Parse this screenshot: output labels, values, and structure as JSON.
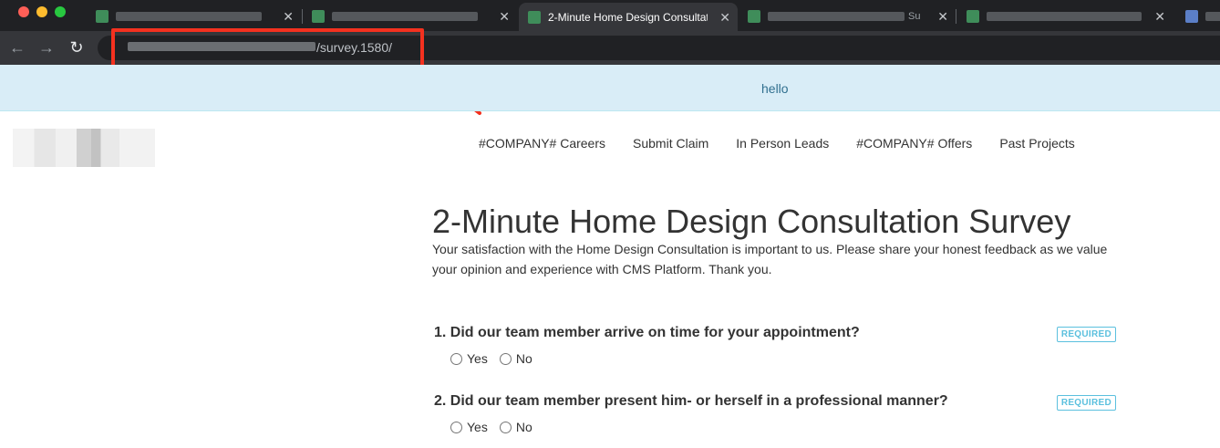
{
  "browser": {
    "tabs": [
      {
        "id": "tab1",
        "title": "",
        "active": false,
        "favicon": "green-square-icon"
      },
      {
        "id": "tab2",
        "title": "",
        "active": false,
        "favicon": "green-square-icon"
      },
      {
        "id": "tab3",
        "title": "2-Minute Home Design Consultation Survey",
        "active": true,
        "favicon": "survey-favicon-icon"
      },
      {
        "id": "tab4",
        "title": "Su",
        "active": false,
        "favicon": "green-square-icon"
      },
      {
        "id": "tab5",
        "title": "",
        "active": false,
        "favicon": "green-square-icon"
      },
      {
        "id": "tab6",
        "title": "",
        "active": false,
        "favicon": "blue-doc-icon"
      }
    ],
    "url_visible": "/survey.1580/",
    "icons": {
      "back": "←",
      "forward": "→",
      "reload": "↻",
      "close": "✕"
    }
  },
  "banner": {
    "text": "hello"
  },
  "nav": {
    "items": [
      "#COMPANY# Careers",
      "Submit Claim",
      "In Person Leads",
      "#COMPANY# Offers",
      "Past Projects"
    ]
  },
  "survey": {
    "title": "2-Minute Home Design Consultation Survey",
    "intro": "Your satisfaction with the Home Design Consultation is important to us. Please share your honest feedback as we value your opinion and experience with CMS Platform. Thank you.",
    "questions": [
      {
        "text": "1. Did our team member arrive on time for your appointment?",
        "badge": "REQUIRED",
        "options": [
          "Yes",
          "No"
        ]
      },
      {
        "text": "2. Did our team member present him- or herself in a professional manner?",
        "badge": "REQUIRED",
        "options": [
          "Yes",
          "No"
        ]
      }
    ]
  },
  "colors": {
    "annotation_red": "#f4311f",
    "banner_bg": "#d9edf7",
    "banner_text": "#31708f",
    "badge": "#5bc0de"
  }
}
